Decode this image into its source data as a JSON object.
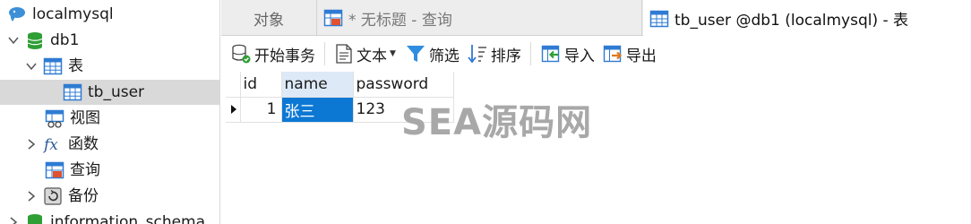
{
  "sidebar": {
    "items": [
      {
        "label": "localmysql",
        "icon": "connection-icon"
      },
      {
        "label": "db1",
        "icon": "database-icon",
        "expanded": true
      },
      {
        "label": "表",
        "icon": "tables-folder-icon",
        "expanded": true
      },
      {
        "label": "tb_user",
        "icon": "table-icon",
        "selected": true
      },
      {
        "label": "视图",
        "icon": "view-icon"
      },
      {
        "label": "函数",
        "icon": "function-icon"
      },
      {
        "label": "查询",
        "icon": "query-icon"
      },
      {
        "label": "备份",
        "icon": "backup-icon"
      },
      {
        "label": "information_schema",
        "icon": "database-icon"
      }
    ]
  },
  "tabs": {
    "objects": "对象",
    "query": "* 无标题 - 查询",
    "active": "tb_user @db1 (localmysql) - 表"
  },
  "toolbar": {
    "begin_transaction": "开始事务",
    "text": "文本",
    "filter": "筛选",
    "sort": "排序",
    "import": "导入",
    "export": "导出"
  },
  "grid": {
    "columns": [
      "id",
      "name",
      "password"
    ],
    "rows": [
      {
        "id": "1",
        "name": "张三",
        "password": "123"
      }
    ]
  },
  "watermark": "SEA源码网",
  "colors": {
    "selection": "#0c78d4",
    "db_icon": "#2f9e35",
    "table_icon": "#2f7bd3",
    "tree_selected": "#d9d9d9"
  }
}
